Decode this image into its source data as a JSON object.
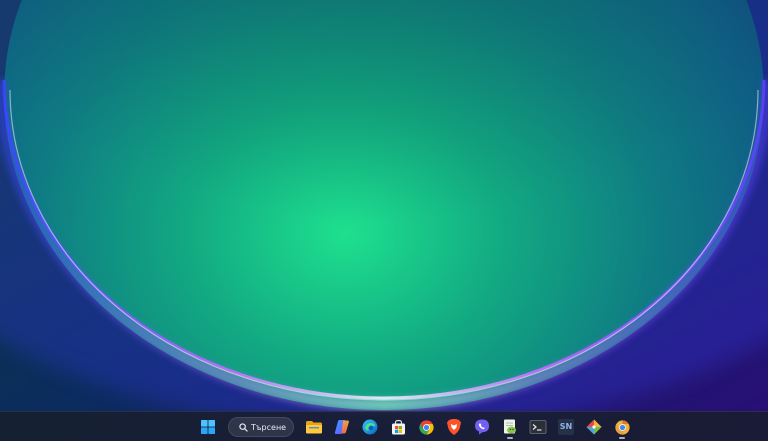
{
  "desktop": {
    "wallpaper_name": "windows-11-bloom-wallpaper"
  },
  "taskbar": {
    "start_icon": "windows-start-icon",
    "search": {
      "icon": "search-icon",
      "placeholder": "Търсене"
    },
    "apps": [
      {
        "name": "file-explorer",
        "icon": "folder-icon",
        "running": false
      },
      {
        "name": "copilot",
        "icon": "copilot-icon",
        "running": false
      },
      {
        "name": "microsoft-edge",
        "icon": "edge-icon",
        "running": false
      },
      {
        "name": "microsoft-store",
        "icon": "store-icon",
        "running": false
      },
      {
        "name": "google-chrome",
        "icon": "chrome-icon",
        "running": false
      },
      {
        "name": "brave-browser",
        "icon": "brave-icon",
        "running": false
      },
      {
        "name": "viber",
        "icon": "viber-icon",
        "running": false
      },
      {
        "name": "notepad-plus-plus",
        "icon": "notepad-plus-plus-icon",
        "running": true
      },
      {
        "name": "terminal",
        "icon": "terminal-icon",
        "running": false
      },
      {
        "name": "sn-app",
        "icon": "sn-icon",
        "label": "SN",
        "running": false
      },
      {
        "name": "git-tool",
        "icon": "git-icon",
        "running": false
      },
      {
        "name": "chrome-canary",
        "icon": "chrome-canary-icon",
        "running": true
      }
    ]
  },
  "colors": {
    "taskbar_bg": "#181e2c",
    "accent_blue": "#3b9cff",
    "wallpaper_glow_green": "#19c87e",
    "wallpaper_glow_purple": "#8a2be2"
  }
}
